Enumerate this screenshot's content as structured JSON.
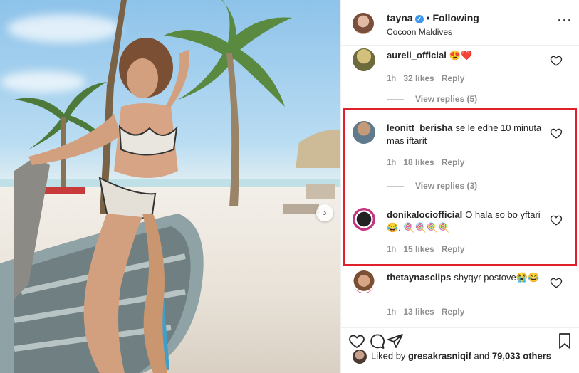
{
  "header": {
    "username": "tayna",
    "status": "Following",
    "location": "Cocoon Maldives"
  },
  "comments": [
    {
      "user": "aureli_official",
      "text": "😍❤️",
      "time": "1h",
      "likes": "32 likes",
      "reply": "Reply"
    },
    {
      "user": "leonitt_berisha",
      "text": "se le edhe 10 minuta mas iftarit",
      "time": "1h",
      "likes": "18 likes",
      "reply": "Reply"
    },
    {
      "user": "donikalociofficial",
      "text": "O hala so bo yftari 😂. 🍭🍭🍭🍭",
      "time": "1h",
      "likes": "15 likes",
      "reply": "Reply"
    },
    {
      "user": "thetaynasclips",
      "text": "shyqyr postove😭😂",
      "time": "1h",
      "likes": "13 likes",
      "reply": "Reply"
    }
  ],
  "replies": [
    {
      "label": "View replies (5)"
    },
    {
      "label": "View replies (3)"
    }
  ],
  "footer": {
    "liked_prefix": "Liked by",
    "liked_user": "gresakrasniqif",
    "liked_and": "and",
    "liked_count": "79,033 others"
  },
  "colors": {
    "highlight": "#e0202a",
    "verified": "#3897f0",
    "heart_red": "#ed4956"
  },
  "icons": [
    "verified-icon",
    "more-options-icon",
    "heart-icon",
    "comment-icon",
    "share-icon",
    "bookmark-icon",
    "chevron-right-icon"
  ]
}
